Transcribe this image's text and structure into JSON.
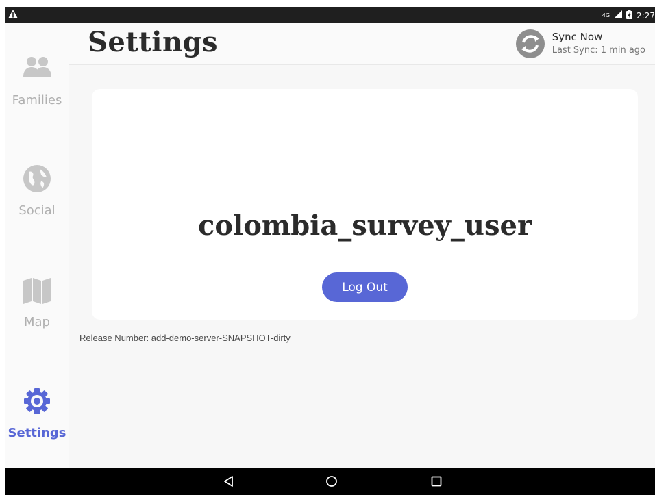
{
  "status_bar": {
    "warning_icon": "warning-triangle-icon",
    "network": "4G",
    "time": "2:27"
  },
  "sidebar": {
    "items": [
      {
        "label": "Families",
        "icon": "families-icon",
        "active": false
      },
      {
        "label": "Social",
        "icon": "globe-icon",
        "active": false
      },
      {
        "label": "Map",
        "icon": "map-icon",
        "active": false
      },
      {
        "label": "Settings",
        "icon": "gear-icon",
        "active": true
      }
    ]
  },
  "header": {
    "title": "Settings",
    "sync": {
      "title": "Sync Now",
      "subtitle": "Last Sync: 1 min ago",
      "icon": "sync-icon"
    }
  },
  "main": {
    "username": "colombia_survey_user",
    "logout_label": "Log Out",
    "release_number": "Release Number: add-demo-server-SNAPSHOT-dirty"
  },
  "colors": {
    "accent": "#5867d6",
    "inactive": "#b0b0b0",
    "background": "#f7f7f7",
    "card": "#ffffff",
    "statusbar": "#1f1f1f"
  },
  "nav_bar": {
    "buttons": [
      "back-icon",
      "home-icon",
      "recents-icon"
    ]
  }
}
